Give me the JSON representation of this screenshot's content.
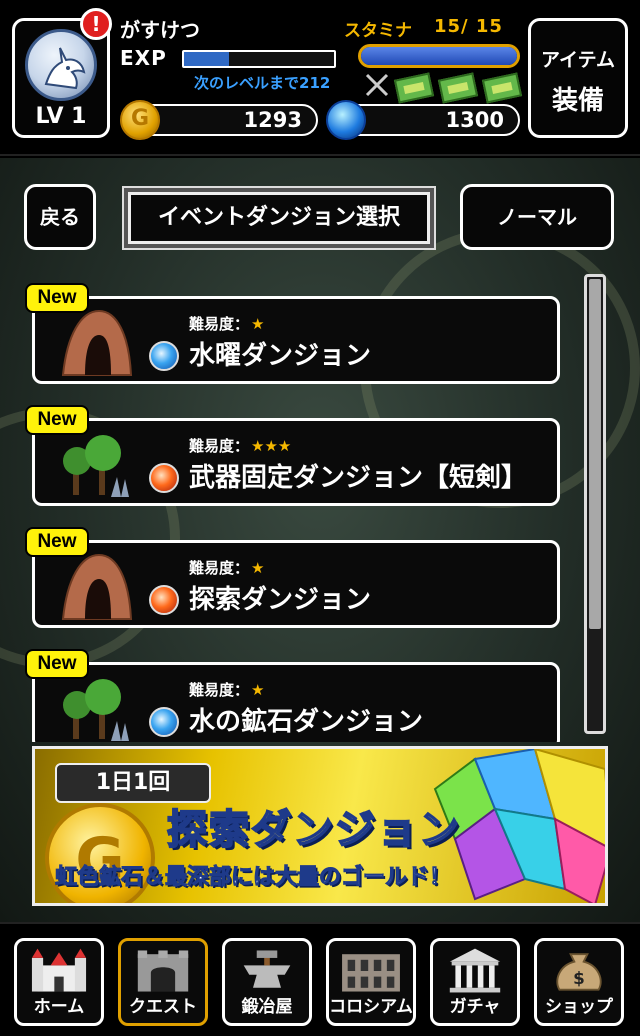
{
  "player": {
    "name": "がすけつ",
    "level_label": "LV 1",
    "alert_badge": "!",
    "exp_label": "EXP",
    "exp_progress": 0.3,
    "exp_next": "次のレベルまで212"
  },
  "stamina": {
    "label": "スタミナ",
    "value": "15/ 15",
    "progress": 1.0
  },
  "currency": {
    "gold": "1293",
    "gems": "1300"
  },
  "item_button": {
    "line1": "アイテム",
    "line2": "装備"
  },
  "nav": {
    "back_label": "戻る",
    "title": "イベントダンジョン選択",
    "normal_label": "ノーマル"
  },
  "dungeons": [
    {
      "tag": "New",
      "difficulty_label": "難易度：",
      "stars": "★",
      "element": "water",
      "name": "水曜ダンジョン",
      "thumb": "cave"
    },
    {
      "tag": "New",
      "difficulty_label": "難易度：",
      "stars": "★★★",
      "element": "fire",
      "name": "武器固定ダンジョン【短剣】",
      "thumb": "forest"
    },
    {
      "tag": "New",
      "difficulty_label": "難易度：",
      "stars": "★",
      "element": "fire",
      "name": "探索ダンジョン",
      "thumb": "cave"
    },
    {
      "tag": "New",
      "difficulty_label": "難易度：",
      "stars": "★",
      "element": "water",
      "name": "水の鉱石ダンジョン",
      "thumb": "forest"
    }
  ],
  "banner": {
    "daily": "1日1回",
    "title": "探索ダンジョン",
    "subtitle": "虹色鉱石＆最深部には大量のゴールド！"
  },
  "footer": {
    "tabs": [
      {
        "label": "ホーム",
        "icon": "castle-icon"
      },
      {
        "label": "クエスト",
        "icon": "gate-icon",
        "active": true
      },
      {
        "label": "鍛冶屋",
        "icon": "anvil-icon"
      },
      {
        "label": "コロシアム",
        "icon": "colosseum-icon"
      },
      {
        "label": "ガチャ",
        "icon": "temple-icon"
      },
      {
        "label": "ショップ",
        "icon": "money-bag-icon"
      }
    ]
  },
  "colors": {
    "accent_gold": "#f5b800",
    "exp_blue": "#3aa0ff",
    "new_tag": "#fff20a"
  }
}
